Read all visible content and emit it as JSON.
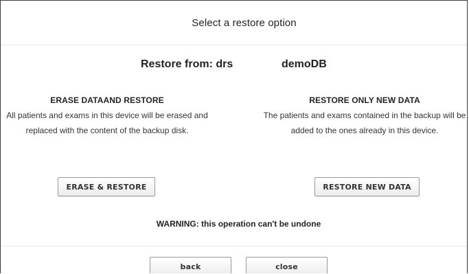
{
  "dialog": {
    "title": "Select a restore option"
  },
  "source": {
    "label": "Restore from: drs",
    "database": "demoDB"
  },
  "options": {
    "erase": {
      "heading": "ERASE DATAAND RESTORE",
      "description": "All patients and exams in this device will be erased and replaced with the content of the backup disk.",
      "button_label": "ERASE & RESTORE"
    },
    "restore_new": {
      "heading": "RESTORE ONLY NEW DATA",
      "description": "The patients and exams contained in the backup will be added to the ones already in this device.",
      "button_label": "RESTORE NEW DATA"
    }
  },
  "warning": "WARNING: this operation can't be undone",
  "footer": {
    "back_label": "back",
    "close_label": "close"
  }
}
